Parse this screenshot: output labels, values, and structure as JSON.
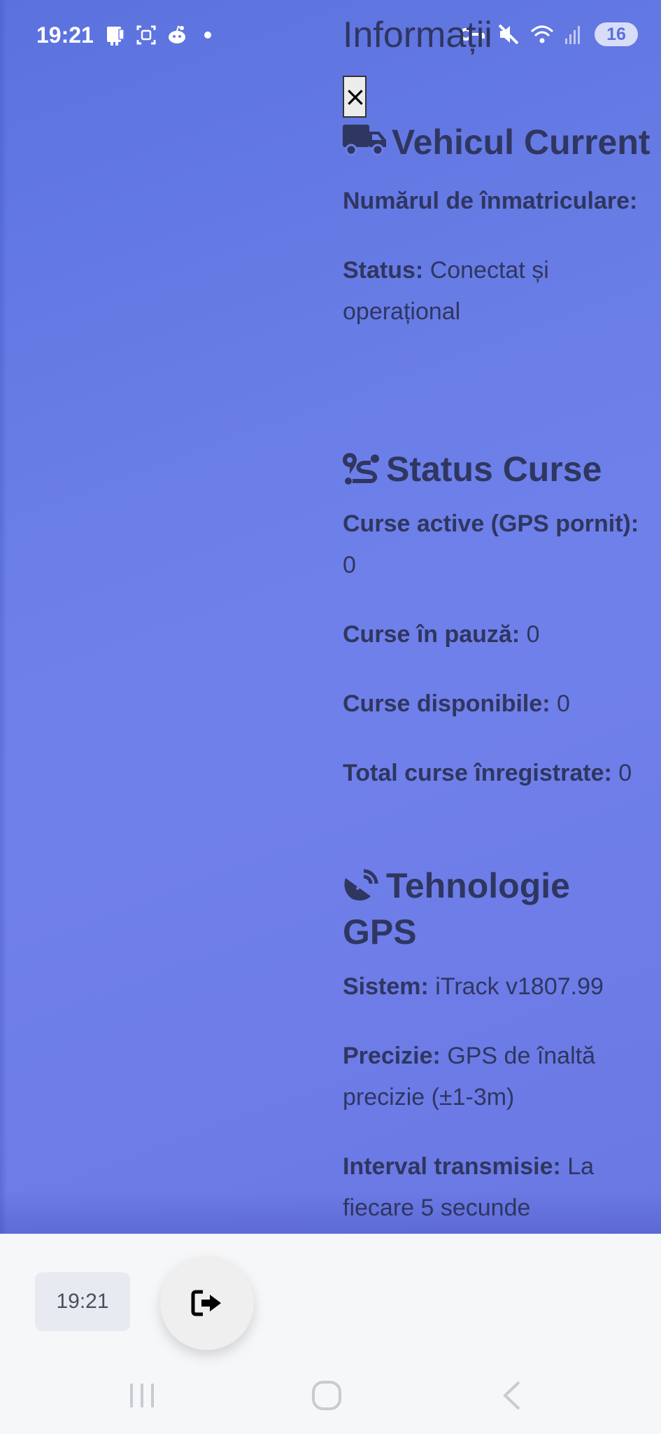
{
  "status_bar": {
    "time": "19:21",
    "battery": "16",
    "icons_left": [
      "tablet-icon",
      "screenshot-icon",
      "reddit-icon",
      "notification-dot-icon"
    ],
    "icons_right": [
      "key-icon",
      "mute-icon",
      "wifi-icon",
      "signal-icon",
      "battery-icon"
    ]
  },
  "panel": {
    "title": "Informații",
    "close_label": "×",
    "vehicle": {
      "heading": "Vehicul Current",
      "fields": [
        {
          "label": "Numărul de înmatriculare:",
          "value": ""
        },
        {
          "label": "Status:",
          "value": "Conectat și operațional"
        }
      ]
    },
    "courses": {
      "heading": "Status Curse",
      "fields": [
        {
          "label": "Curse active (GPS pornit):",
          "value": "0"
        },
        {
          "label": "Curse în pauză:",
          "value": "0"
        },
        {
          "label": "Curse disponibile:",
          "value": "0"
        },
        {
          "label": "Total curse înregistrate:",
          "value": "0"
        }
      ]
    },
    "gps": {
      "heading": "Tehnologie GPS",
      "fields": [
        {
          "label": "Sistem:",
          "value": "iTrack v1807.99"
        },
        {
          "label": "Precizie:",
          "value": "GPS de înaltă precizie (±1-3m)"
        },
        {
          "label": "Interval transmisie:",
          "value": "La fiecare 5 secunde"
        }
      ]
    }
  },
  "bottom": {
    "time": "19:21",
    "logout_icon": "logout-icon"
  },
  "colors": {
    "background": "#6a7ee6",
    "text": "#2f3660",
    "bottom_bar": "#f6f7f9"
  }
}
